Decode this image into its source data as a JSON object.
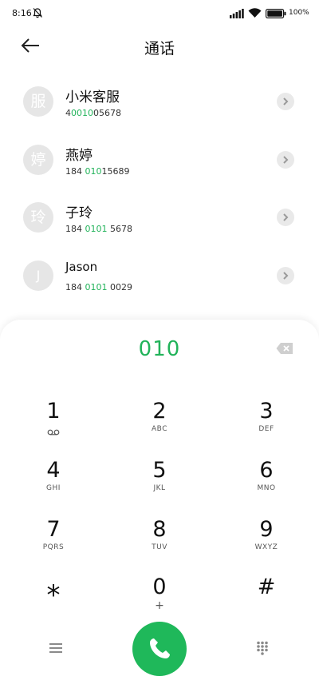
{
  "status_bar": {
    "time": "8:16",
    "battery_text": "100%"
  },
  "header": {
    "title": "通话"
  },
  "contacts": [
    {
      "avatar_char": "服",
      "name": "小米客服",
      "number_pre": "4",
      "number_hl": "0010",
      "number_post": "05678"
    },
    {
      "avatar_char": "婷",
      "name": "燕婷",
      "number_pre": "184 ",
      "number_hl": "010",
      "number_post": "15689"
    },
    {
      "avatar_char": "玲",
      "name": "子玲",
      "number_pre": "184 ",
      "number_hl": "0101",
      "number_post": " 5678"
    },
    {
      "avatar_char": "J",
      "name": "Jason",
      "number_pre": "184 ",
      "number_hl": "0101",
      "number_post": " 0029"
    }
  ],
  "dialer": {
    "input": "010",
    "keys": [
      {
        "digit": "1",
        "letters": ""
      },
      {
        "digit": "2",
        "letters": "ABC"
      },
      {
        "digit": "3",
        "letters": "DEF"
      },
      {
        "digit": "4",
        "letters": "GHI"
      },
      {
        "digit": "5",
        "letters": "JKL"
      },
      {
        "digit": "6",
        "letters": "MNO"
      },
      {
        "digit": "7",
        "letters": "PQRS"
      },
      {
        "digit": "8",
        "letters": "TUV"
      },
      {
        "digit": "9",
        "letters": "WXYZ"
      },
      {
        "digit": "*",
        "letters": ""
      },
      {
        "digit": "0",
        "letters": "+"
      },
      {
        "digit": "#",
        "letters": ""
      }
    ]
  },
  "colors": {
    "accent": "#22b35a",
    "call_button": "#1fb85a",
    "avatar_bg": "#e6e6e6"
  },
  "icons": {
    "voicemail": "voicemail-icon",
    "back": "arrow-left-icon",
    "backspace": "backspace-icon",
    "call": "phone-icon",
    "menu": "menu-icon",
    "keypad": "keypad-icon"
  }
}
